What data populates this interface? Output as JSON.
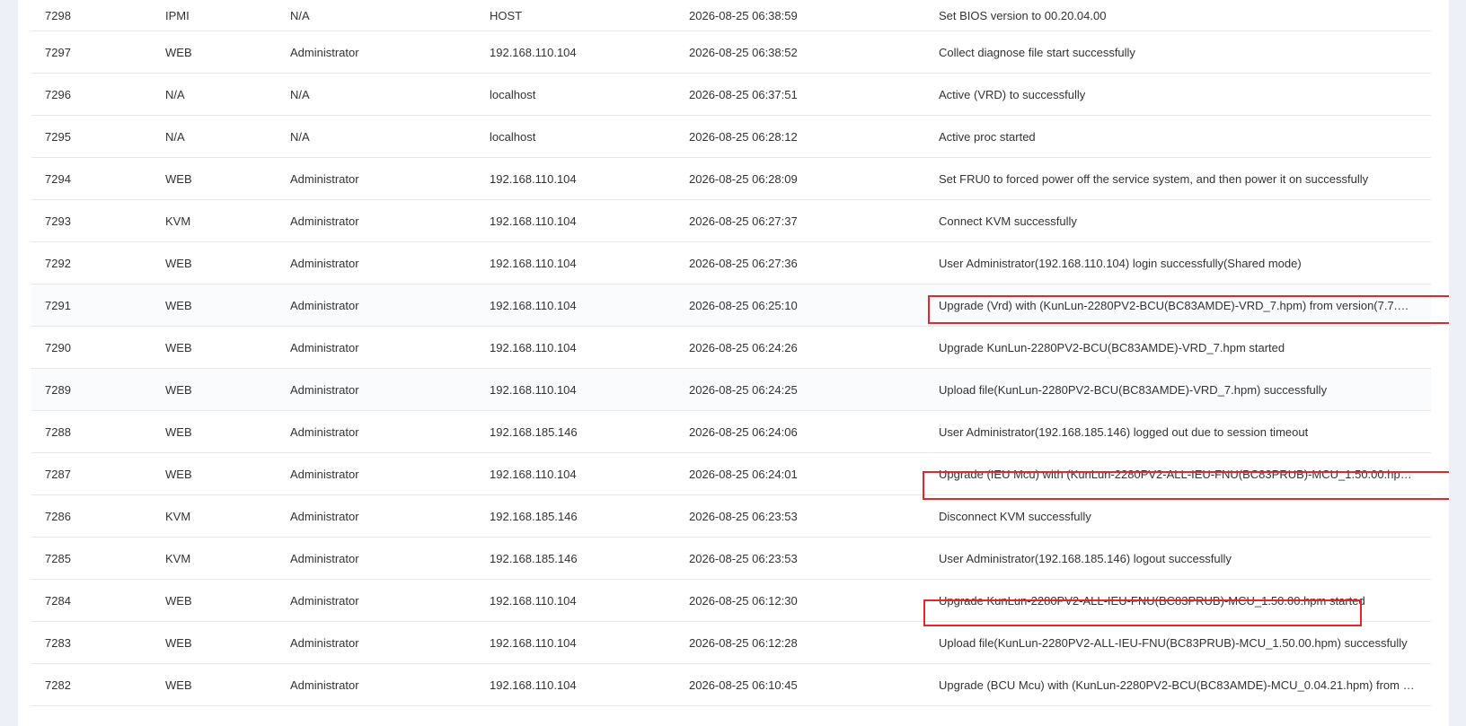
{
  "log_table": {
    "rows": [
      {
        "id": "7298",
        "interface": "IPMI",
        "user": "N/A",
        "address": "HOST",
        "time": "2026-08-25 06:38:59",
        "description": "Set BIOS version to 00.20.04.00"
      },
      {
        "id": "7297",
        "interface": "WEB",
        "user": "Administrator",
        "address": "192.168.110.104",
        "time": "2026-08-25 06:38:52",
        "description": "Collect diagnose file start successfully"
      },
      {
        "id": "7296",
        "interface": "N/A",
        "user": "N/A",
        "address": "localhost",
        "time": "2026-08-25 06:37:51",
        "description": "Active (VRD) to successfully"
      },
      {
        "id": "7295",
        "interface": "N/A",
        "user": "N/A",
        "address": "localhost",
        "time": "2026-08-25 06:28:12",
        "description": "Active proc started"
      },
      {
        "id": "7294",
        "interface": "WEB",
        "user": "Administrator",
        "address": "192.168.110.104",
        "time": "2026-08-25 06:28:09",
        "description": "Set FRU0 to forced power off the service system, and then power it on successfully"
      },
      {
        "id": "7293",
        "interface": "KVM",
        "user": "Administrator",
        "address": "192.168.110.104",
        "time": "2026-08-25 06:27:37",
        "description": "Connect KVM successfully"
      },
      {
        "id": "7292",
        "interface": "WEB",
        "user": "Administrator",
        "address": "192.168.110.104",
        "time": "2026-08-25 06:27:36",
        "description": "User Administrator(192.168.110.104) login successfully(Shared mode)"
      },
      {
        "id": "7291",
        "interface": "WEB",
        "user": "Administrator",
        "address": "192.168.110.104",
        "time": "2026-08-25 06:25:10",
        "description": "Upgrade (Vrd) with (KunLun-2280PV2-BCU(BC83AMDE)-VRD_7.hpm) from version(7.7.7.7..."
      },
      {
        "id": "7290",
        "interface": "WEB",
        "user": "Administrator",
        "address": "192.168.110.104",
        "time": "2026-08-25 06:24:26",
        "description": "Upgrade KunLun-2280PV2-BCU(BC83AMDE)-VRD_7.hpm started"
      },
      {
        "id": "7289",
        "interface": "WEB",
        "user": "Administrator",
        "address": "192.168.110.104",
        "time": "2026-08-25 06:24:25",
        "description": "Upload file(KunLun-2280PV2-BCU(BC83AMDE)-VRD_7.hpm) successfully"
      },
      {
        "id": "7288",
        "interface": "WEB",
        "user": "Administrator",
        "address": "192.168.185.146",
        "time": "2026-08-25 06:24:06",
        "description": "User Administrator(192.168.185.146) logged out due to session timeout"
      },
      {
        "id": "7287",
        "interface": "WEB",
        "user": "Administrator",
        "address": "192.168.110.104",
        "time": "2026-08-25 06:24:01",
        "description": "Upgrade (IEU Mcu) with (KunLun-2280PV2-ALL-IEU-FNU(BC83PRUB)-MCU_1.50.00.hpm) fr..."
      },
      {
        "id": "7286",
        "interface": "KVM",
        "user": "Administrator",
        "address": "192.168.185.146",
        "time": "2026-08-25 06:23:53",
        "description": "Disconnect KVM successfully"
      },
      {
        "id": "7285",
        "interface": "KVM",
        "user": "Administrator",
        "address": "192.168.185.146",
        "time": "2026-08-25 06:23:53",
        "description": "User Administrator(192.168.185.146) logout successfully"
      },
      {
        "id": "7284",
        "interface": "WEB",
        "user": "Administrator",
        "address": "192.168.110.104",
        "time": "2026-08-25 06:12:30",
        "description": "Upgrade KunLun-2280PV2-ALL-IEU-FNU(BC83PRUB)-MCU_1.50.00.hpm started"
      },
      {
        "id": "7283",
        "interface": "WEB",
        "user": "Administrator",
        "address": "192.168.110.104",
        "time": "2026-08-25 06:12:28",
        "description": "Upload file(KunLun-2280PV2-ALL-IEU-FNU(BC83PRUB)-MCU_1.50.00.hpm) successfully"
      },
      {
        "id": "7282",
        "interface": "WEB",
        "user": "Administrator",
        "address": "192.168.110.104",
        "time": "2026-08-25 06:10:45",
        "description": "Upgrade (BCU Mcu) with (KunLun-2280PV2-BCU(BC83AMDE)-MCU_0.04.21.hpm) from ver..."
      }
    ]
  },
  "colors": {
    "highlight_border": "#e8262a",
    "page_background": "#edf1f7"
  }
}
